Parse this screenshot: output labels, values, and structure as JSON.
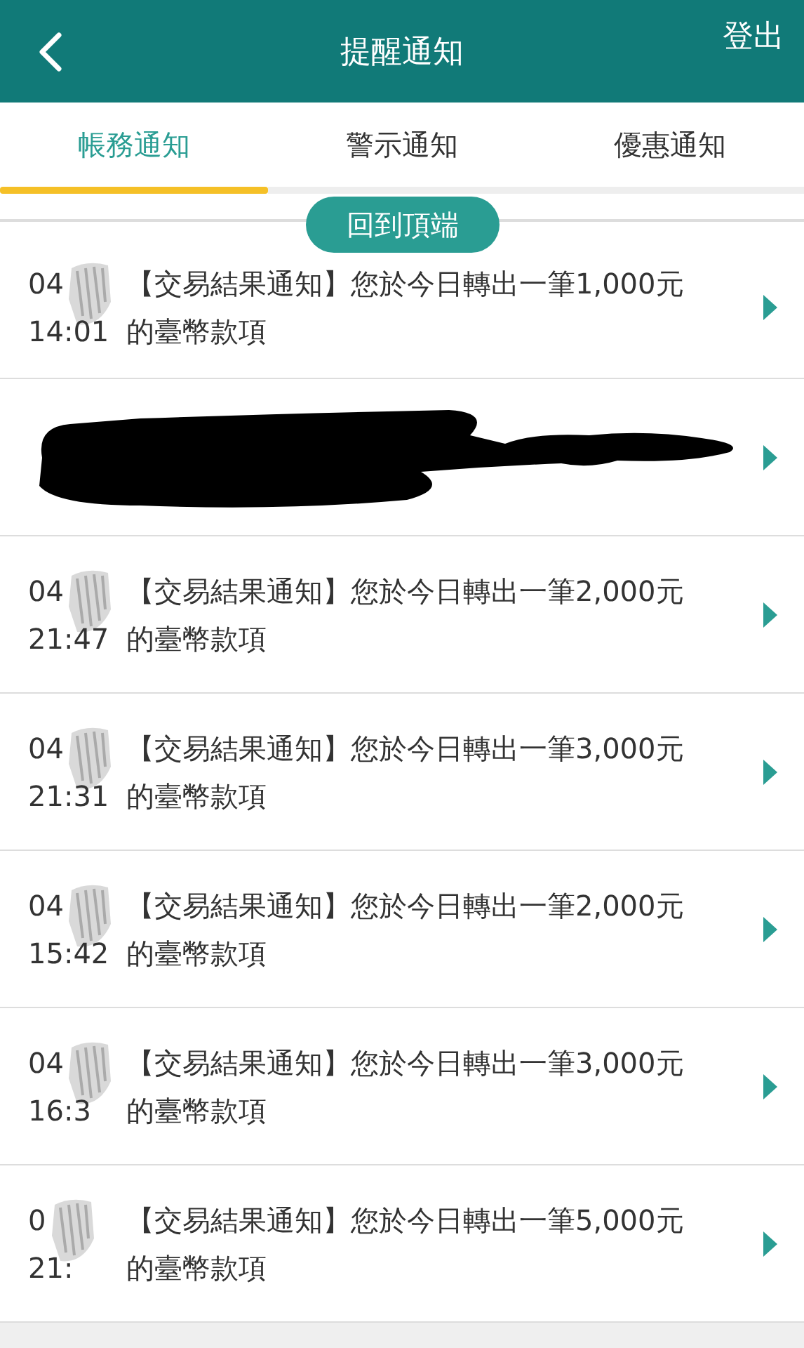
{
  "header": {
    "title": "提醒通知",
    "logout": "登出"
  },
  "tabs": [
    {
      "label": "帳務通知",
      "selected": true
    },
    {
      "label": "警示通知",
      "selected": false
    },
    {
      "label": "優惠通知",
      "selected": false
    }
  ],
  "back_to_top": "回到頂端",
  "notifications": [
    {
      "kind": "message",
      "date": "04",
      "time": "14:01",
      "message": "【交易結果通知】您於今日轉出一筆1,000元的臺幣款項"
    },
    {
      "kind": "redacted"
    },
    {
      "kind": "message",
      "date": "04",
      "time": "21:47",
      "message": "【交易結果通知】您於今日轉出一筆2,000元的臺幣款項"
    },
    {
      "kind": "message",
      "date": "04",
      "time": "21:31",
      "message": "【交易結果通知】您於今日轉出一筆3,000元的臺幣款項"
    },
    {
      "kind": "message",
      "date": "04",
      "time": "15:42",
      "message": "【交易結果通知】您於今日轉出一筆2,000元的臺幣款項"
    },
    {
      "kind": "message",
      "date": "04",
      "time": "16:3",
      "message": "【交易結果通知】您於今日轉出一筆3,000元的臺幣款項"
    },
    {
      "kind": "message",
      "date": "0",
      "time": "21:",
      "message": "【交易結果通知】您於今日轉出一筆5,000元的臺幣款項"
    }
  ]
}
